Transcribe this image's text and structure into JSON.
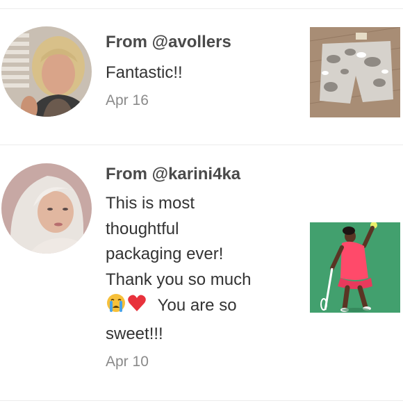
{
  "reviews": [
    {
      "from": "From @avollers",
      "message_lines": [
        "Fantastic!!"
      ],
      "date": "Apr 16",
      "avatar_icon": "user-photo-avatar",
      "thumbnail_icon": "camo-shorts-photo"
    },
    {
      "from": "From @karini4ka",
      "message_lines": [
        "This is most",
        "thoughtful",
        "packaging ever!",
        "Thank you so much",
        "You are so",
        "sweet!!!"
      ],
      "emojis": [
        "crying-face-emoji",
        "red-heart-emoji"
      ],
      "date": "Apr 10",
      "avatar_icon": "user-photo-avatar",
      "thumbnail_icon": "tennis-player-photo"
    }
  ],
  "colors": {
    "divider": "#ececec",
    "from_text": "#4a4a4a",
    "message_text": "#333333",
    "date_text": "#8a8a8a"
  }
}
